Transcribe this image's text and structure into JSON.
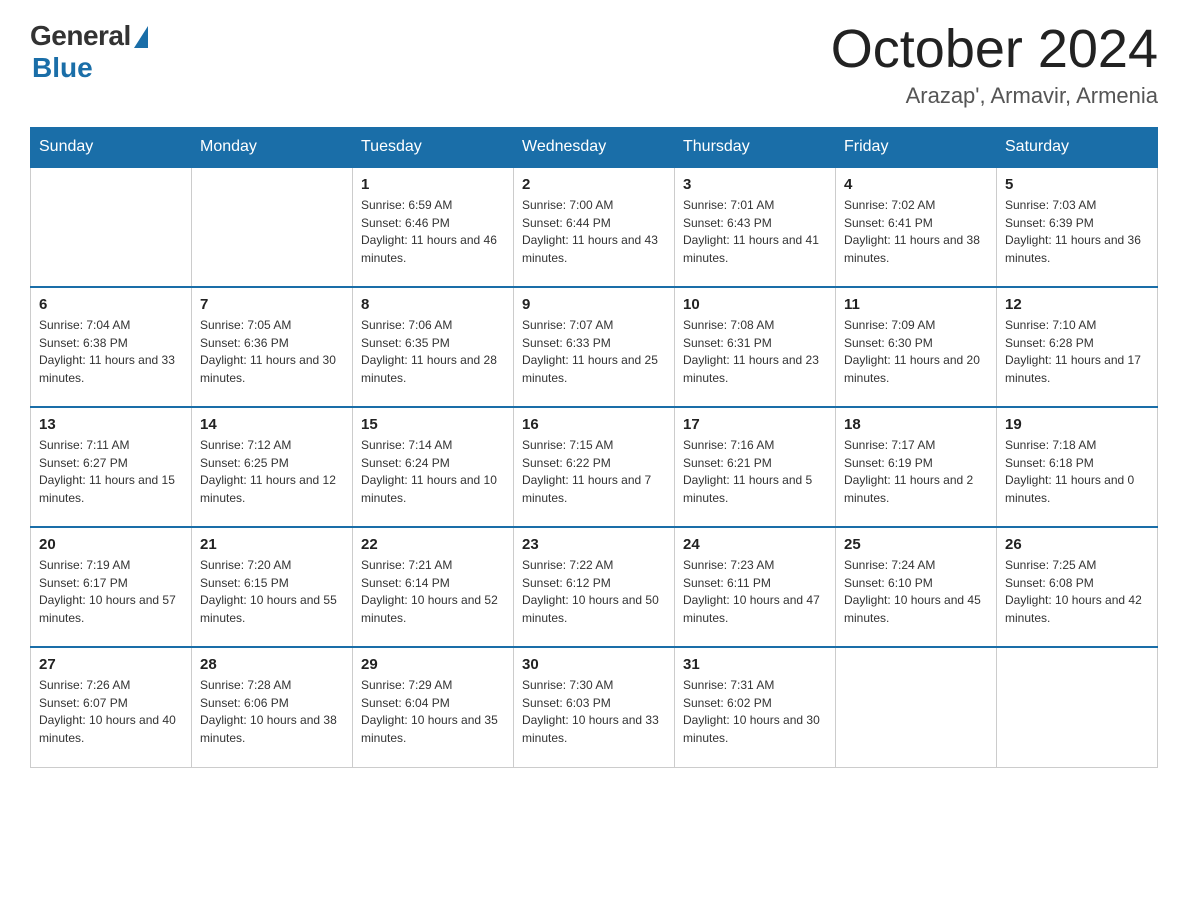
{
  "logo": {
    "general_text": "General",
    "blue_text": "Blue"
  },
  "header": {
    "month": "October 2024",
    "location": "Arazap', Armavir, Armenia"
  },
  "days_of_week": [
    "Sunday",
    "Monday",
    "Tuesday",
    "Wednesday",
    "Thursday",
    "Friday",
    "Saturday"
  ],
  "weeks": [
    [
      {
        "day": "",
        "sunrise": "",
        "sunset": "",
        "daylight": ""
      },
      {
        "day": "",
        "sunrise": "",
        "sunset": "",
        "daylight": ""
      },
      {
        "day": "1",
        "sunrise": "Sunrise: 6:59 AM",
        "sunset": "Sunset: 6:46 PM",
        "daylight": "Daylight: 11 hours and 46 minutes."
      },
      {
        "day": "2",
        "sunrise": "Sunrise: 7:00 AM",
        "sunset": "Sunset: 6:44 PM",
        "daylight": "Daylight: 11 hours and 43 minutes."
      },
      {
        "day": "3",
        "sunrise": "Sunrise: 7:01 AM",
        "sunset": "Sunset: 6:43 PM",
        "daylight": "Daylight: 11 hours and 41 minutes."
      },
      {
        "day": "4",
        "sunrise": "Sunrise: 7:02 AM",
        "sunset": "Sunset: 6:41 PM",
        "daylight": "Daylight: 11 hours and 38 minutes."
      },
      {
        "day": "5",
        "sunrise": "Sunrise: 7:03 AM",
        "sunset": "Sunset: 6:39 PM",
        "daylight": "Daylight: 11 hours and 36 minutes."
      }
    ],
    [
      {
        "day": "6",
        "sunrise": "Sunrise: 7:04 AM",
        "sunset": "Sunset: 6:38 PM",
        "daylight": "Daylight: 11 hours and 33 minutes."
      },
      {
        "day": "7",
        "sunrise": "Sunrise: 7:05 AM",
        "sunset": "Sunset: 6:36 PM",
        "daylight": "Daylight: 11 hours and 30 minutes."
      },
      {
        "day": "8",
        "sunrise": "Sunrise: 7:06 AM",
        "sunset": "Sunset: 6:35 PM",
        "daylight": "Daylight: 11 hours and 28 minutes."
      },
      {
        "day": "9",
        "sunrise": "Sunrise: 7:07 AM",
        "sunset": "Sunset: 6:33 PM",
        "daylight": "Daylight: 11 hours and 25 minutes."
      },
      {
        "day": "10",
        "sunrise": "Sunrise: 7:08 AM",
        "sunset": "Sunset: 6:31 PM",
        "daylight": "Daylight: 11 hours and 23 minutes."
      },
      {
        "day": "11",
        "sunrise": "Sunrise: 7:09 AM",
        "sunset": "Sunset: 6:30 PM",
        "daylight": "Daylight: 11 hours and 20 minutes."
      },
      {
        "day": "12",
        "sunrise": "Sunrise: 7:10 AM",
        "sunset": "Sunset: 6:28 PM",
        "daylight": "Daylight: 11 hours and 17 minutes."
      }
    ],
    [
      {
        "day": "13",
        "sunrise": "Sunrise: 7:11 AM",
        "sunset": "Sunset: 6:27 PM",
        "daylight": "Daylight: 11 hours and 15 minutes."
      },
      {
        "day": "14",
        "sunrise": "Sunrise: 7:12 AM",
        "sunset": "Sunset: 6:25 PM",
        "daylight": "Daylight: 11 hours and 12 minutes."
      },
      {
        "day": "15",
        "sunrise": "Sunrise: 7:14 AM",
        "sunset": "Sunset: 6:24 PM",
        "daylight": "Daylight: 11 hours and 10 minutes."
      },
      {
        "day": "16",
        "sunrise": "Sunrise: 7:15 AM",
        "sunset": "Sunset: 6:22 PM",
        "daylight": "Daylight: 11 hours and 7 minutes."
      },
      {
        "day": "17",
        "sunrise": "Sunrise: 7:16 AM",
        "sunset": "Sunset: 6:21 PM",
        "daylight": "Daylight: 11 hours and 5 minutes."
      },
      {
        "day": "18",
        "sunrise": "Sunrise: 7:17 AM",
        "sunset": "Sunset: 6:19 PM",
        "daylight": "Daylight: 11 hours and 2 minutes."
      },
      {
        "day": "19",
        "sunrise": "Sunrise: 7:18 AM",
        "sunset": "Sunset: 6:18 PM",
        "daylight": "Daylight: 11 hours and 0 minutes."
      }
    ],
    [
      {
        "day": "20",
        "sunrise": "Sunrise: 7:19 AM",
        "sunset": "Sunset: 6:17 PM",
        "daylight": "Daylight: 10 hours and 57 minutes."
      },
      {
        "day": "21",
        "sunrise": "Sunrise: 7:20 AM",
        "sunset": "Sunset: 6:15 PM",
        "daylight": "Daylight: 10 hours and 55 minutes."
      },
      {
        "day": "22",
        "sunrise": "Sunrise: 7:21 AM",
        "sunset": "Sunset: 6:14 PM",
        "daylight": "Daylight: 10 hours and 52 minutes."
      },
      {
        "day": "23",
        "sunrise": "Sunrise: 7:22 AM",
        "sunset": "Sunset: 6:12 PM",
        "daylight": "Daylight: 10 hours and 50 minutes."
      },
      {
        "day": "24",
        "sunrise": "Sunrise: 7:23 AM",
        "sunset": "Sunset: 6:11 PM",
        "daylight": "Daylight: 10 hours and 47 minutes."
      },
      {
        "day": "25",
        "sunrise": "Sunrise: 7:24 AM",
        "sunset": "Sunset: 6:10 PM",
        "daylight": "Daylight: 10 hours and 45 minutes."
      },
      {
        "day": "26",
        "sunrise": "Sunrise: 7:25 AM",
        "sunset": "Sunset: 6:08 PM",
        "daylight": "Daylight: 10 hours and 42 minutes."
      }
    ],
    [
      {
        "day": "27",
        "sunrise": "Sunrise: 7:26 AM",
        "sunset": "Sunset: 6:07 PM",
        "daylight": "Daylight: 10 hours and 40 minutes."
      },
      {
        "day": "28",
        "sunrise": "Sunrise: 7:28 AM",
        "sunset": "Sunset: 6:06 PM",
        "daylight": "Daylight: 10 hours and 38 minutes."
      },
      {
        "day": "29",
        "sunrise": "Sunrise: 7:29 AM",
        "sunset": "Sunset: 6:04 PM",
        "daylight": "Daylight: 10 hours and 35 minutes."
      },
      {
        "day": "30",
        "sunrise": "Sunrise: 7:30 AM",
        "sunset": "Sunset: 6:03 PM",
        "daylight": "Daylight: 10 hours and 33 minutes."
      },
      {
        "day": "31",
        "sunrise": "Sunrise: 7:31 AM",
        "sunset": "Sunset: 6:02 PM",
        "daylight": "Daylight: 10 hours and 30 minutes."
      },
      {
        "day": "",
        "sunrise": "",
        "sunset": "",
        "daylight": ""
      },
      {
        "day": "",
        "sunrise": "",
        "sunset": "",
        "daylight": ""
      }
    ]
  ]
}
